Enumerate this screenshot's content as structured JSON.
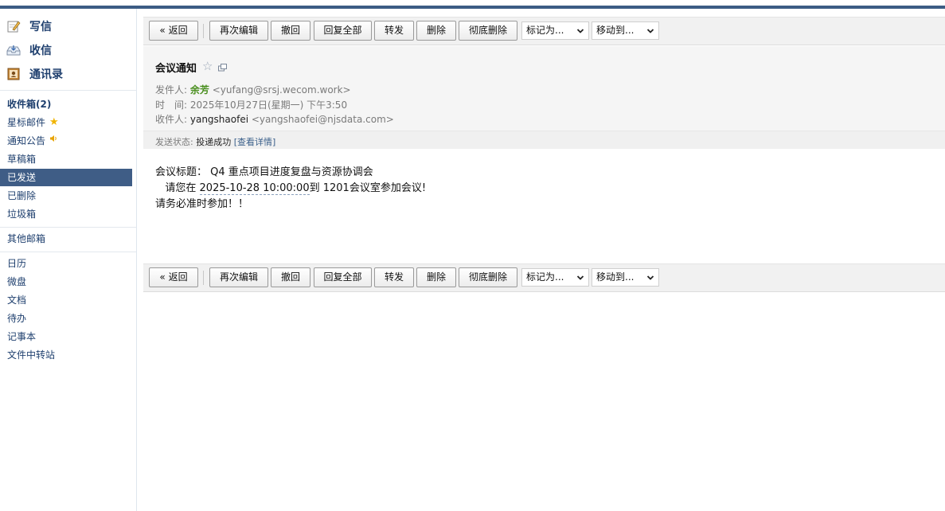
{
  "sidebar": {
    "compose": "写信",
    "receive": "收信",
    "contacts": "通讯录",
    "folders": [
      "收件箱(2)",
      "星标邮件",
      "通知公告",
      "草稿箱",
      "已发送",
      "已删除",
      "垃圾箱"
    ],
    "other": "其他邮箱",
    "apps": [
      "日历",
      "微盘",
      "文档",
      "待办",
      "记事本",
      "文件中转站"
    ]
  },
  "toolbar": {
    "back": "« 返回",
    "edit_again": "再次编辑",
    "recall": "撤回",
    "reply_all": "回复全部",
    "forward": "转发",
    "delete": "删除",
    "delete_forever": "彻底删除",
    "mark_as": "标记为...",
    "move_to": "移动到..."
  },
  "mail": {
    "subject": "会议通知",
    "from_label": "发件人:",
    "from_name": "余芳",
    "from_email": "<yufang@srsj.wecom.work>",
    "time_label": "时　间:",
    "time": "2025年10月27日(星期一) 下午3:50",
    "to_label": "收件人:",
    "to_name": "yangshaofei",
    "to_email": "<yangshaofei@njsdata.com>",
    "status_label": "发送状态:",
    "status": "投递成功",
    "details": "[查看详情]",
    "body": {
      "line1": "会议标题： Q4 重点项目进度复盘与资源协调会",
      "line2_prefix": "   请您在 ",
      "line2_datetime": "2025-10-28 10:00:00",
      "line2_suffix": "到 1201会议室参加会议!",
      "line3": "请务必准时参加！！"
    }
  },
  "colors": {
    "brand": "#3c5c84",
    "active_folder": "#3f5d86",
    "sender_name": "#4a8f1f"
  }
}
